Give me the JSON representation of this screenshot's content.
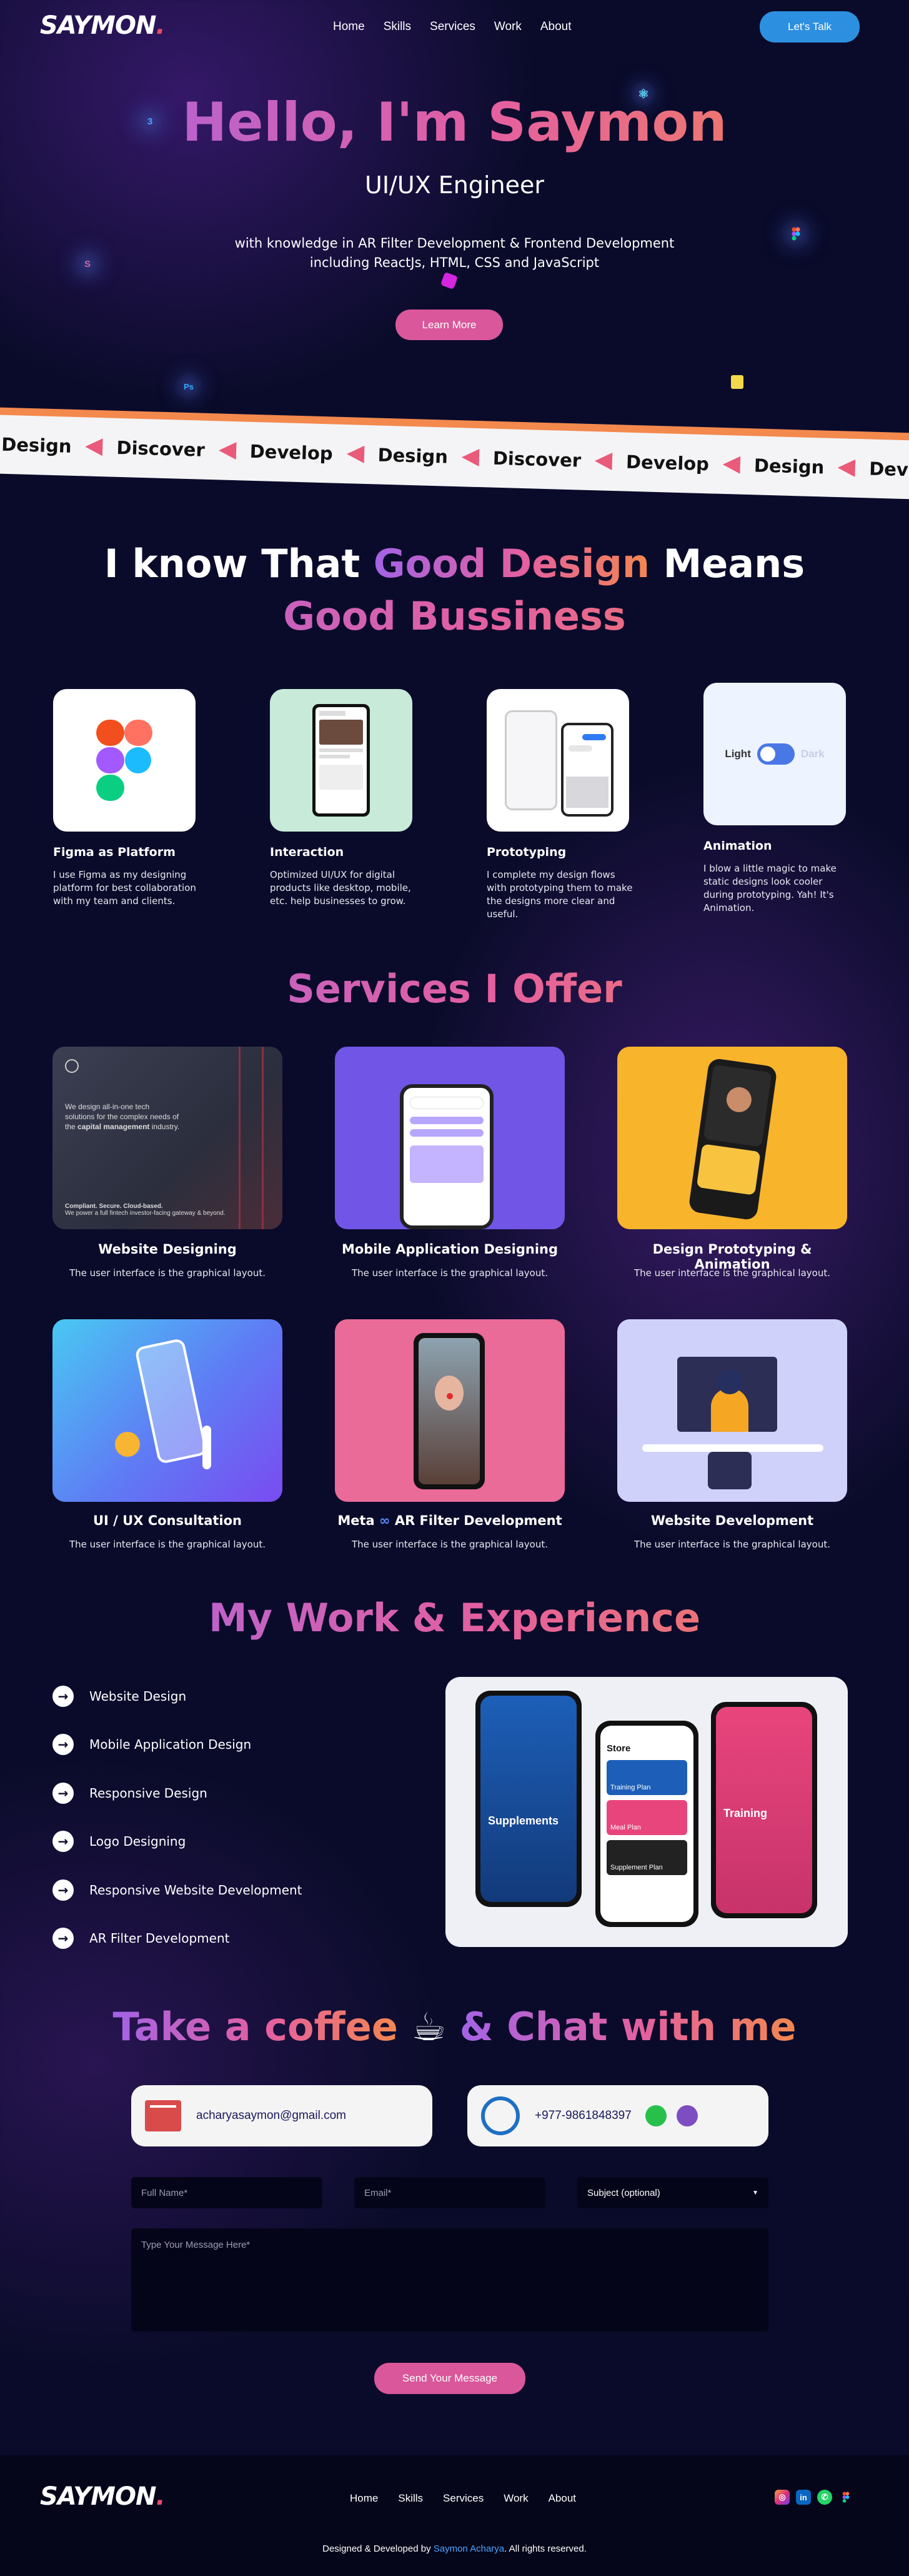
{
  "header": {
    "logo": "SAYMON",
    "logo_dot": ".",
    "nav": [
      "Home",
      "Skills",
      "Services",
      "Work",
      "About"
    ],
    "cta": "Let's Talk"
  },
  "hero": {
    "title": "Hello, I'm Saymon",
    "role": "UI/UX Engineer",
    "description": "with knowledge in AR Filter Development & Frontend Development including ReactJs, HTML, CSS and JavaScript",
    "button": "Learn More",
    "icons": [
      "css3-icon",
      "react-icon",
      "figma-icon",
      "sass-icon",
      "photoshop-icon",
      "javascript-icon",
      "ar-icon"
    ]
  },
  "ribbon": {
    "words": [
      "Design",
      "Discover",
      "Develop",
      "Design",
      "Discover",
      "Develop",
      "Design",
      "Develop"
    ]
  },
  "skills": {
    "title_start": "I know That",
    "title_accent": "Good Design",
    "title_end": "Means",
    "title_line2": "Good Bussiness",
    "items": [
      {
        "name": "Figma as Platform",
        "desc": "I use Figma as my designing platform for best collaboration with my team and clients."
      },
      {
        "name": "Interaction",
        "desc": "Optimized UI/UX for digital products like desktop, mobile, etc. help businesses to grow."
      },
      {
        "name": "Prototyping",
        "desc": "I complete my design flows with prototyping them to make the designs more clear and useful."
      },
      {
        "name": "Animation",
        "desc": "I blow a little magic to make static designs look cooler during prototyping. Yah! It's Animation."
      }
    ],
    "toggle": {
      "light": "Light",
      "dark": "Dark"
    }
  },
  "services": {
    "title": "Services I Offer",
    "items": [
      {
        "name": "Website Designing",
        "desc": "The user interface is the graphical layout."
      },
      {
        "name": "Mobile Application Designing",
        "desc": "The user interface is the graphical layout."
      },
      {
        "name": "Design Prototyping & Animation",
        "desc": "The user interface is the graphical layout."
      },
      {
        "name": "UI / UX Consultation",
        "desc": "The user interface is the graphical layout."
      },
      {
        "name": "Meta",
        "name_rest": "AR Filter Development",
        "desc": "The user interface is the graphical layout."
      },
      {
        "name": "Website Development",
        "desc": "The user interface is the graphical layout."
      }
    ],
    "web_card": {
      "headline_1": "We design all-in-one tech",
      "headline_2": "solutions for the complex needs of",
      "headline_3a": "the",
      "headline_3b": "capital management",
      "headline_3c": "industry.",
      "foot_1": "Compliant. Secure. Cloud-based.",
      "foot_2": "We power a full fintech investor-facing gateway & beyond."
    }
  },
  "work": {
    "title": "My Work & Experience",
    "items": [
      "Website Design",
      "Mobile Application Design",
      "Responsive Design",
      "Logo Designing",
      "Responsive Website Development",
      "AR Filter Development"
    ],
    "mockup": {
      "supplements": "Supplements",
      "store": "Store",
      "training": "Training",
      "training_plan": "Training Plan",
      "meal_plan": "Meal Plan",
      "supplement_plan": "Supplement Plan"
    }
  },
  "contact": {
    "title_start": "Take a coffee",
    "coffee": "☕",
    "title_end": "& Chat with me",
    "email": "acharyasaymon@gmail.com",
    "phone": "+977-9861848397",
    "form": {
      "full_name": "Full Name*",
      "email": "Email*",
      "subject": "Subject (optional)",
      "message": "Type Your Message Here*",
      "submit": "Send Your Message"
    }
  },
  "footer": {
    "logo": "SAYMON",
    "logo_dot": ".",
    "nav": [
      "Home",
      "Skills",
      "Services",
      "Work",
      "About"
    ],
    "credit_start": "Designed & Developed by",
    "credit_name": "Saymon Acharya",
    "credit_end": ". All rights reserved."
  },
  "colors": {
    "accent_purple": "#a363e6",
    "accent_pink": "#e5609e",
    "accent_orange": "#f3874f",
    "button_blue": "#2d8fe0",
    "button_pink": "#d9579a",
    "bg": "#0a0b2a"
  }
}
